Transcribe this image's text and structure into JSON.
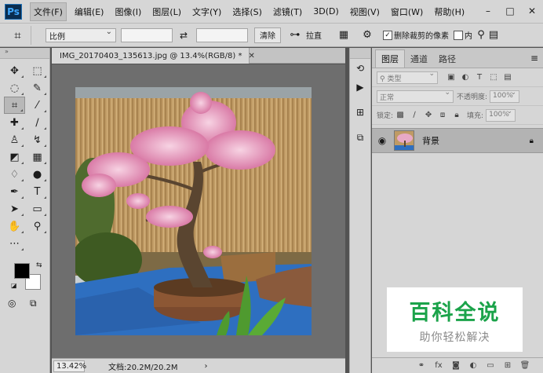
{
  "app": {
    "logo": "Ps",
    "menus": [
      "文件(F)",
      "编辑(E)",
      "图像(I)",
      "图层(L)",
      "文字(Y)",
      "选择(S)",
      "滤镜(T)",
      "3D(D)",
      "视图(V)",
      "窗口(W)",
      "帮助(H)"
    ],
    "window_controls": [
      "–",
      "□",
      "✕"
    ]
  },
  "options": {
    "tool_icon": "crop-icon",
    "ratio": "比例",
    "ratio_width": "",
    "ratio_height": "",
    "swap_glyph": "⇄",
    "clear": "清除",
    "straighten": "拉直",
    "delete_cropped_label": "删除裁剪的像素",
    "delete_cropped_checked": true,
    "content_aware_short": "内",
    "gear_glyph": "⚙",
    "search_glyph": "⚲",
    "workspace_glyph": "▤"
  },
  "tools": {
    "items": [
      {
        "name": "move-tool",
        "glyph": "✥"
      },
      {
        "name": "marquee-tool",
        "glyph": "⬚"
      },
      {
        "name": "lasso-tool",
        "glyph": "◌"
      },
      {
        "name": "quick-select-tool",
        "glyph": "✎"
      },
      {
        "name": "crop-tool",
        "glyph": "⌗",
        "active": true
      },
      {
        "name": "eyedropper-tool",
        "glyph": "⁄"
      },
      {
        "name": "healing-tool",
        "glyph": "✚"
      },
      {
        "name": "brush-tool",
        "glyph": "∕"
      },
      {
        "name": "stamp-tool",
        "glyph": "♙"
      },
      {
        "name": "history-brush-tool",
        "glyph": "↯"
      },
      {
        "name": "eraser-tool",
        "glyph": "◩"
      },
      {
        "name": "gradient-tool",
        "glyph": "▦"
      },
      {
        "name": "blur-tool",
        "glyph": "♢"
      },
      {
        "name": "dodge-tool",
        "glyph": "●"
      },
      {
        "name": "pen-tool",
        "glyph": "✒"
      },
      {
        "name": "type-tool",
        "glyph": "T"
      },
      {
        "name": "path-select-tool",
        "glyph": "➤"
      },
      {
        "name": "shape-tool",
        "glyph": "▭"
      },
      {
        "name": "hand-tool",
        "glyph": "✋"
      },
      {
        "name": "zoom-tool",
        "glyph": "⚲"
      },
      {
        "name": "extras-tool",
        "glyph": "⋯"
      }
    ],
    "foreground_color": "#000000",
    "background_color": "#ffffff"
  },
  "document": {
    "tab_title": "IMG_20170403_135613.jpg @ 13.4%(RGB/8) *",
    "close_glyph": "✕",
    "zoom": "13.42%",
    "doc_info": "文档:20.2M/20.2M",
    "status_arrow": "›"
  },
  "dock": {
    "items": [
      "history-icon",
      "play-icon",
      "brush-preset-icon",
      "layer-comp-icon"
    ]
  },
  "layers": {
    "tabs": [
      "图层",
      "通道",
      "路径"
    ],
    "active_tab": 0,
    "filter_kind": "类型",
    "blend_mode": "正常",
    "opacity_label": "不透明度:",
    "opacity": "100%",
    "lock_label": "锁定:",
    "fill_label": "填充:",
    "fill": "100%",
    "layer_name": "背景",
    "footer_icons": [
      "link-icon",
      "fx-icon",
      "mask-icon",
      "adjustment-icon",
      "group-icon",
      "new-layer-icon",
      "trash-icon"
    ]
  },
  "watermark": {
    "title": "百科全说",
    "subtitle": "助你轻松解决"
  }
}
